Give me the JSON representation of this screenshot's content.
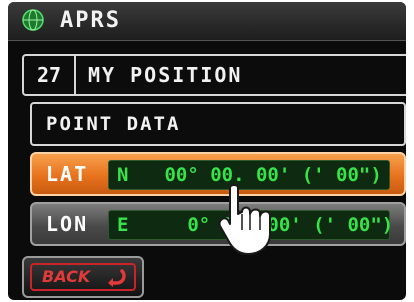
{
  "header": {
    "title": "APRS",
    "icon": "aprs-globe-icon"
  },
  "my_position": {
    "number": "27",
    "label": "MY POSITION"
  },
  "point_data": {
    "label": "POINT DATA"
  },
  "latitude": {
    "label": "LAT",
    "hemisphere": "N",
    "value": " 00° 00. 00' (' 00\")",
    "selected": true
  },
  "longitude": {
    "label": "LON",
    "hemisphere": "E",
    "value": "   0° 00. 00' (' 00\")",
    "selected": false
  },
  "back_button": {
    "label": "BACK",
    "icon": "back-arrow-icon"
  },
  "colors": {
    "selected_row": "#e8731e",
    "field_text": "#37e24a",
    "back_text": "#e23a3a"
  }
}
